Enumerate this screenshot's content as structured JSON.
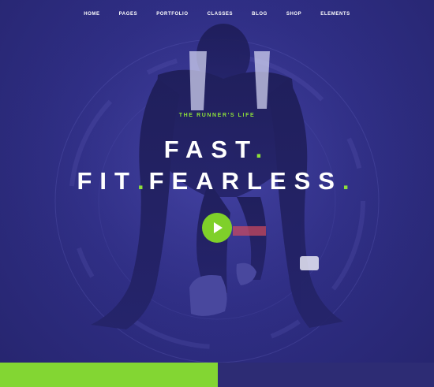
{
  "nav": {
    "items": [
      {
        "label": "HOME"
      },
      {
        "label": "PAGES"
      },
      {
        "label": "PORTFOLIO"
      },
      {
        "label": "CLASSES"
      },
      {
        "label": "BLOG"
      },
      {
        "label": "SHOP"
      },
      {
        "label": "ELEMENTS"
      }
    ]
  },
  "hero": {
    "tagline": "THE RUNNER'S LIFE",
    "headline_line1": "FAST",
    "headline_line2_a": "FIT",
    "headline_line2_b": "FEARLESS",
    "dot": ".",
    "play_icon": "play-icon"
  },
  "colors": {
    "background": "#2f2e85",
    "accent_green": "#83d633",
    "bottom_navy": "#2d2c74"
  }
}
